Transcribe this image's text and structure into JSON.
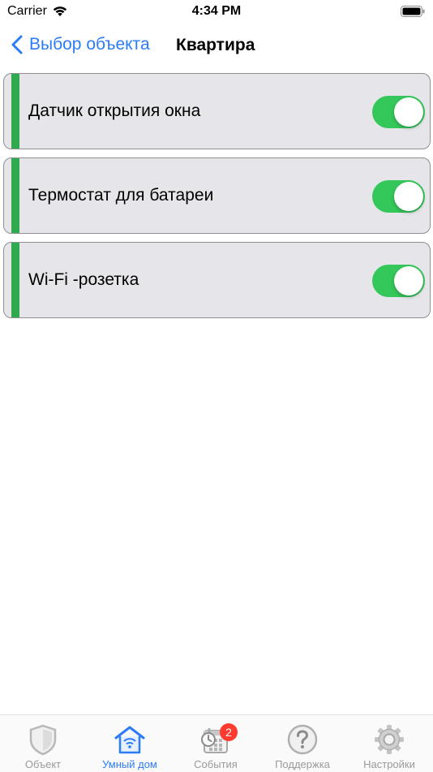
{
  "status_bar": {
    "carrier": "Carrier",
    "time": "4:34 PM"
  },
  "nav": {
    "back_label": "Выбор объекта",
    "title": "Квартира"
  },
  "devices": [
    {
      "label": "Датчик открытия окна",
      "enabled": true
    },
    {
      "label": "Термостат для батареи",
      "enabled": true
    },
    {
      "label": "Wi-Fi -розетка",
      "enabled": true
    }
  ],
  "tabs": [
    {
      "label": "Объект",
      "icon": "shield-icon"
    },
    {
      "label": "Умный дом",
      "icon": "smart-home-icon",
      "active": true
    },
    {
      "label": "События",
      "icon": "calendar-clock-icon",
      "badge": "2"
    },
    {
      "label": "Поддержка",
      "icon": "question-icon"
    },
    {
      "label": "Настройки",
      "icon": "gear-icon"
    }
  ],
  "colors": {
    "accent_blue": "#2b7cf6",
    "switch_on": "#34c759",
    "row_bar": "#2eaa4f",
    "badge": "#ff3b30"
  }
}
